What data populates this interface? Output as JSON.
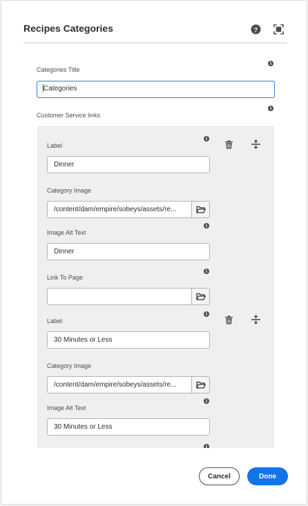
{
  "dialog": {
    "title": "Recipes Categories",
    "help_icon": "help-circle-icon",
    "fullscreen_icon": "fullscreen-icon"
  },
  "categories_title": {
    "label": "Categories Title",
    "value": "Categories"
  },
  "customer_service_links": {
    "label": "Customer Service links",
    "items": [
      {
        "label_label": "Label",
        "label_value": "Dinner",
        "image_label": "Category Image",
        "image_value": "/content/dam/empire/sobeys/assets/re...",
        "alt_label": "Image Alt Text",
        "alt_value": "Dinner",
        "page_label": "Link To Page",
        "page_value": ""
      },
      {
        "label_label": "Label",
        "label_value": "30 Minutes or Less",
        "image_label": "Category Image",
        "image_value": "/content/dam/empire/sobeys/assets/re...",
        "alt_label": "Image Alt Text",
        "alt_value": "30 Minutes or Less"
      }
    ]
  },
  "footer": {
    "cancel_label": "Cancel",
    "done_label": "Done"
  },
  "colors": {
    "accent": "#1473e6",
    "focus": "#2680eb",
    "panel": "#efefef"
  }
}
